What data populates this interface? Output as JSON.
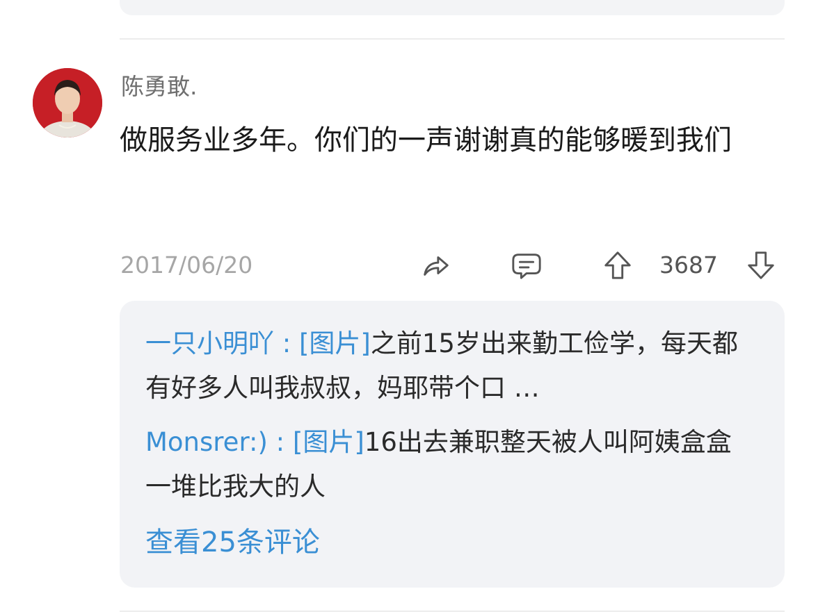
{
  "post": {
    "username": "陈勇敢.",
    "content": "做服务业多年。你们的一声谢谢真的能够暖到我们",
    "date": "2017/06/20",
    "vote_count": "3687"
  },
  "actions": {
    "share_icon": "share-arrow-icon",
    "comment_icon": "comment-bubble-icon",
    "upvote_icon": "arrow-up-icon",
    "downvote_icon": "arrow-down-icon"
  },
  "replies": [
    {
      "name": "一只小明吖",
      "separator": " : ",
      "image_tag": "[图片]",
      "text": "之前15岁出来勤工俭学，每天都有好多人叫我叔叔，妈耶带个口 …"
    },
    {
      "name": "Monsrer:)",
      "separator": " : ",
      "image_tag": "[图片]",
      "text": "16出去兼职整天被人叫阿姨盒盒一堆比我大的人"
    }
  ],
  "view_all_label": "查看25条评论",
  "colors": {
    "link_blue": "#3a8fd4",
    "muted_gray": "#a6a6a6",
    "reply_bg": "#f2f3f6",
    "avatar_bg": "#c61f26"
  }
}
